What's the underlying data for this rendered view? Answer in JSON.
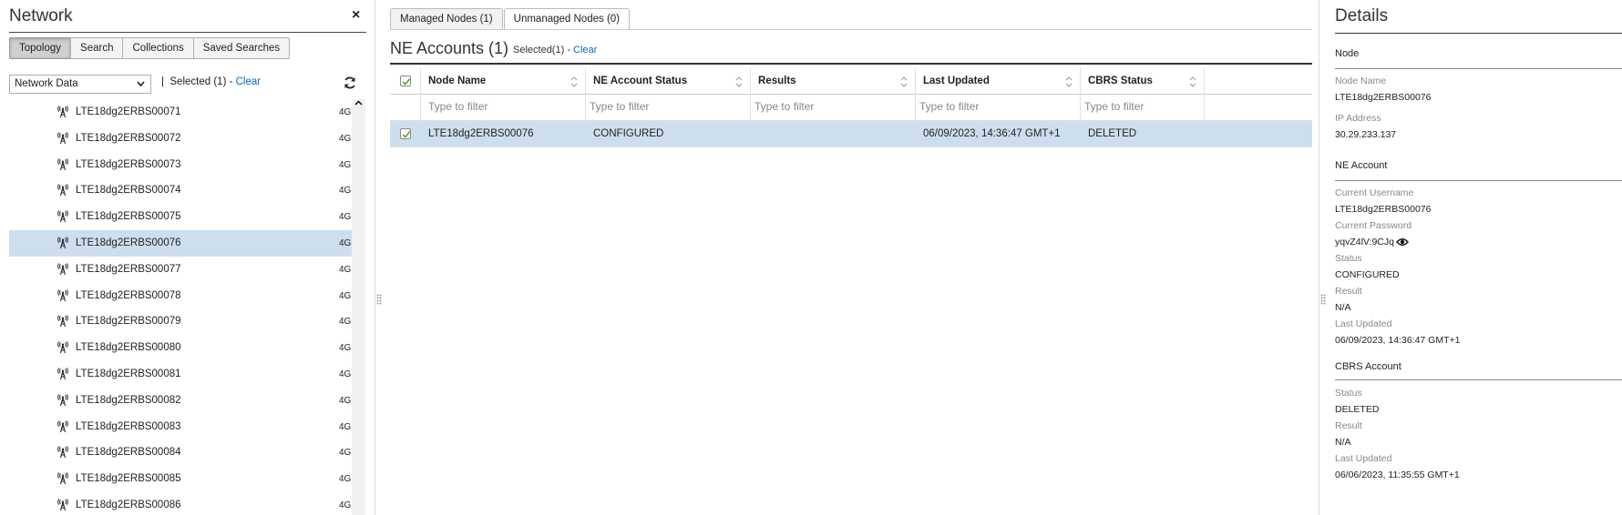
{
  "left": {
    "title": "Network",
    "close": "×",
    "segments": [
      "Topology",
      "Search",
      "Collections",
      "Saved Searches"
    ],
    "select_value": "Network Data",
    "selected_text": "Selected (1) - ",
    "clear": "Clear",
    "nodes": [
      {
        "name": "LTE18dg2ERBS00071",
        "tech": "4G"
      },
      {
        "name": "LTE18dg2ERBS00072",
        "tech": "4G"
      },
      {
        "name": "LTE18dg2ERBS00073",
        "tech": "4G"
      },
      {
        "name": "LTE18dg2ERBS00074",
        "tech": "4G"
      },
      {
        "name": "LTE18dg2ERBS00075",
        "tech": "4G"
      },
      {
        "name": "LTE18dg2ERBS00076",
        "tech": "4G",
        "selected": true
      },
      {
        "name": "LTE18dg2ERBS00077",
        "tech": "4G"
      },
      {
        "name": "LTE18dg2ERBS00078",
        "tech": "4G"
      },
      {
        "name": "LTE18dg2ERBS00079",
        "tech": "4G"
      },
      {
        "name": "LTE18dg2ERBS00080",
        "tech": "4G"
      },
      {
        "name": "LTE18dg2ERBS00081",
        "tech": "4G"
      },
      {
        "name": "LTE18dg2ERBS00082",
        "tech": "4G"
      },
      {
        "name": "LTE18dg2ERBS00083",
        "tech": "4G"
      },
      {
        "name": "LTE18dg2ERBS00084",
        "tech": "4G"
      },
      {
        "name": "LTE18dg2ERBS00085",
        "tech": "4G"
      },
      {
        "name": "LTE18dg2ERBS00086",
        "tech": "4G"
      }
    ]
  },
  "center": {
    "tabs": [
      "Managed Nodes (1)",
      "Unmanaged Nodes (0)"
    ],
    "title": "NE Accounts (1)",
    "selected": "Selected(1)",
    "sep": " - ",
    "clear": "Clear",
    "columns": [
      "Node Name",
      "NE Account Status",
      "Results",
      "Last Updated",
      "CBRS Status"
    ],
    "filter_placeholder": "Type to filter",
    "rows": [
      {
        "node_name": "LTE18dg2ERBS00076",
        "status": "CONFIGURED",
        "results": "",
        "last_updated": "06/09/2023, 14:36:47 GMT+1",
        "cbrs": "DELETED"
      }
    ]
  },
  "details": {
    "title": "Details",
    "node_section": "Node",
    "node_name_label": "Node Name",
    "node_name": "LTE18dg2ERBS00076",
    "ip_label": "IP Address",
    "ip": "30.29.233.137",
    "ne_section": "NE Account",
    "username_label": "Current Username",
    "username": "LTE18dg2ERBS00076",
    "password_label": "Current Password",
    "password": "yqvZ4lV:9CJq",
    "status_label": "Status",
    "status": "CONFIGURED",
    "result_label": "Result",
    "result": "N/A",
    "updated_label": "Last Updated",
    "updated": "06/09/2023, 14:36:47 GMT+1",
    "cbrs_section": "CBRS Account",
    "cbrs_status_label": "Status",
    "cbrs_status": "DELETED",
    "cbrs_result_label": "Result",
    "cbrs_result": "N/A",
    "cbrs_updated_label": "Last Updated",
    "cbrs_updated": "06/06/2023, 11:35:55 GMT+1"
  },
  "colors": {
    "selection": "#cddfee",
    "link": "#0a66c2"
  }
}
